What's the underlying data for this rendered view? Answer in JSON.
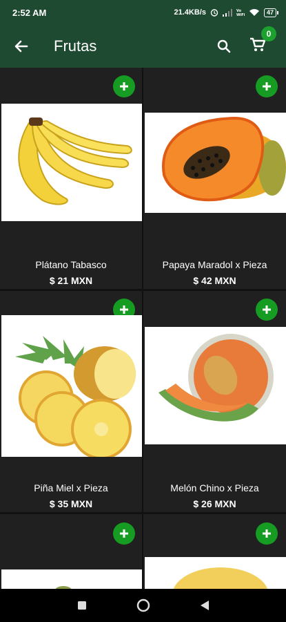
{
  "status": {
    "time": "2:52 AM",
    "speed": "21.4KB/s",
    "battery": "47"
  },
  "appbar": {
    "title": "Frutas",
    "cart_count": "0"
  },
  "products": [
    {
      "name": "Plátano Tabasco",
      "price": "$ 21 MXN"
    },
    {
      "name": "Papaya Maradol x Pieza",
      "price": "$ 42 MXN"
    },
    {
      "name": "Piña Miel x Pieza",
      "price": "$ 35 MXN"
    },
    {
      "name": "Melón Chino x Pieza",
      "price": "$ 26 MXN"
    }
  ],
  "colors": {
    "header": "#1e4a31",
    "add_button": "#169c23",
    "card": "#202020"
  },
  "icons": {
    "back": "arrow-left-icon",
    "search": "search-icon",
    "cart": "cart-icon",
    "add": "plus-icon"
  }
}
